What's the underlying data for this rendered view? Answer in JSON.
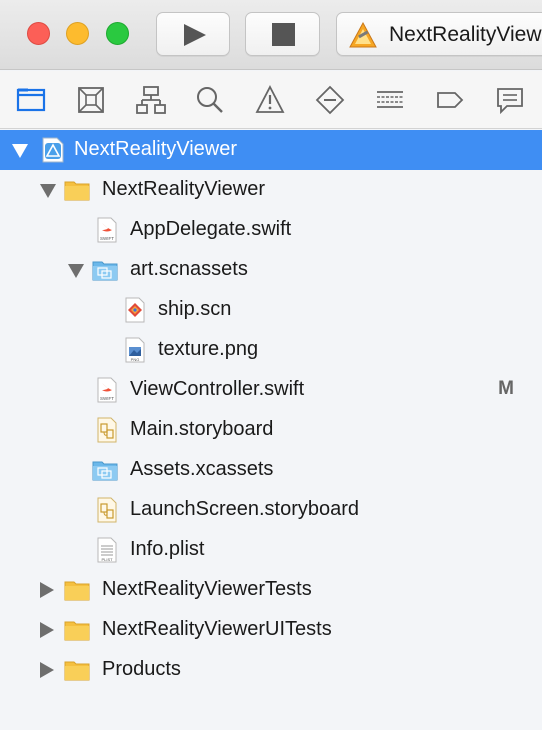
{
  "toolbar": {
    "scheme_label": "NextRealityViewer"
  },
  "colors": {
    "selection": "#3f8ef3",
    "folder": "#f5c040",
    "group_blue": "#6cb8ea",
    "swift_orange": "#f05138"
  },
  "navigator_icons": [
    "folder-icon",
    "source-control-icon",
    "hierarchy-icon",
    "search-icon",
    "warning-icon",
    "test-diamond-icon",
    "debug-list-icon",
    "breakpoint-icon",
    "report-icon"
  ],
  "tree": {
    "project": "NextRealityViewer",
    "group_main": "NextRealityViewer",
    "app_delegate": "AppDelegate.swift",
    "art_assets": "art.scnassets",
    "ship": "ship.scn",
    "texture": "texture.png",
    "view_controller": "ViewController.swift",
    "view_controller_badge": "M",
    "main_storyboard": "Main.storyboard",
    "assets": "Assets.xcassets",
    "launch_storyboard": "LaunchScreen.storyboard",
    "info_plist": "Info.plist",
    "tests": "NextRealityViewerTests",
    "ui_tests": "NextRealityViewerUITests",
    "products": "Products"
  }
}
